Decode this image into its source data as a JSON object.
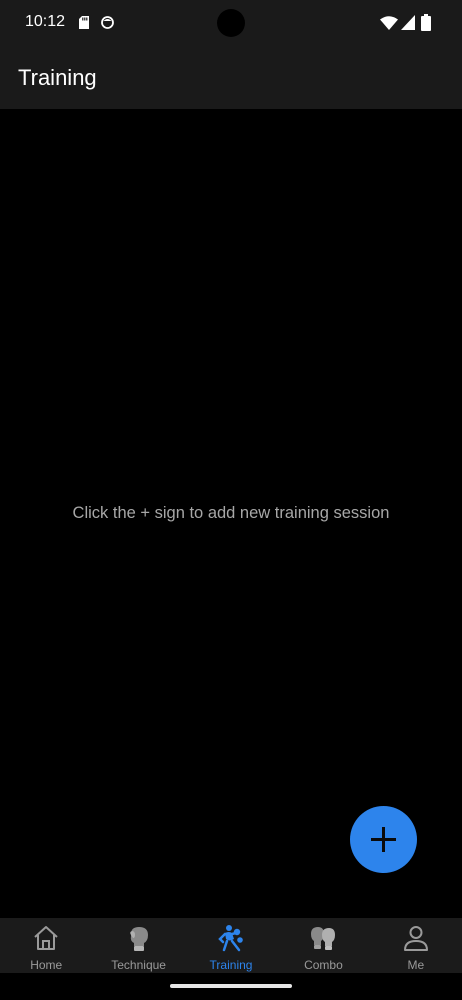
{
  "status_bar": {
    "time": "10:12",
    "icons": [
      "sd-card-icon",
      "download-icon",
      "wifi-icon",
      "cell-signal-icon",
      "battery-icon"
    ]
  },
  "app_bar": {
    "title": "Training"
  },
  "content": {
    "empty_message": "Click the + sign to add new training session"
  },
  "fab": {
    "icon": "plus-icon"
  },
  "bottom_nav": {
    "items": [
      {
        "label": "Home",
        "icon": "home-icon",
        "active": false
      },
      {
        "label": "Technique",
        "icon": "boxing-glove-icon",
        "active": false
      },
      {
        "label": "Training",
        "icon": "boxer-training-icon",
        "active": true
      },
      {
        "label": "Combo",
        "icon": "boxing-gloves-pair-icon",
        "active": false
      },
      {
        "label": "Me",
        "icon": "person-icon",
        "active": false
      }
    ]
  },
  "colors": {
    "accent": "#2d84ec",
    "bar_background": "#1a1a1a",
    "background": "#000000",
    "inactive_nav": "#9a9a9a",
    "message_text": "#a7a7a7"
  }
}
